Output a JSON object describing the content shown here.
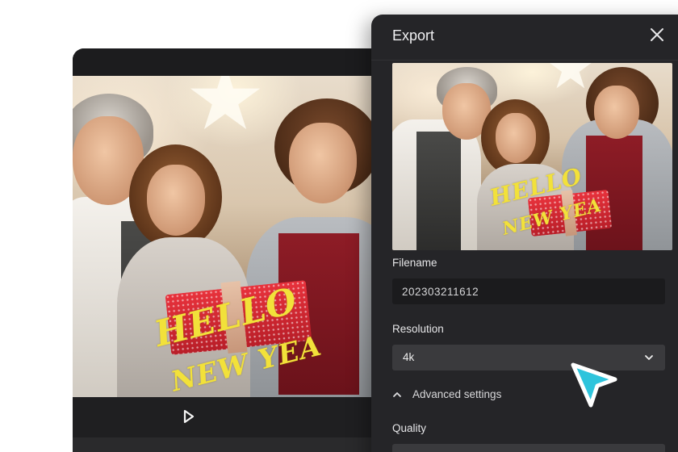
{
  "export_panel": {
    "title": "Export",
    "filename": {
      "label": "Filename",
      "value": "202303211612"
    },
    "resolution": {
      "label": "Resolution",
      "selected": "4k"
    },
    "advanced_settings_label": "Advanced settings",
    "quality_label": "Quality"
  },
  "overlay_text": {
    "line1": "HELLO",
    "line2": "NEW YEA"
  },
  "icons": {
    "close": "close-icon",
    "chevron_down": "chevron-down-icon",
    "chevron_up": "chevron-up-icon",
    "play": "play-icon",
    "cursor": "cursor-arrow-icon"
  },
  "colors": {
    "panel_bg": "#252528",
    "input_bg": "#1b1b1d",
    "select_bg": "#3a3a3d",
    "cursor_accent": "#2ec4dc",
    "text_overlay": "#f2e13a"
  }
}
